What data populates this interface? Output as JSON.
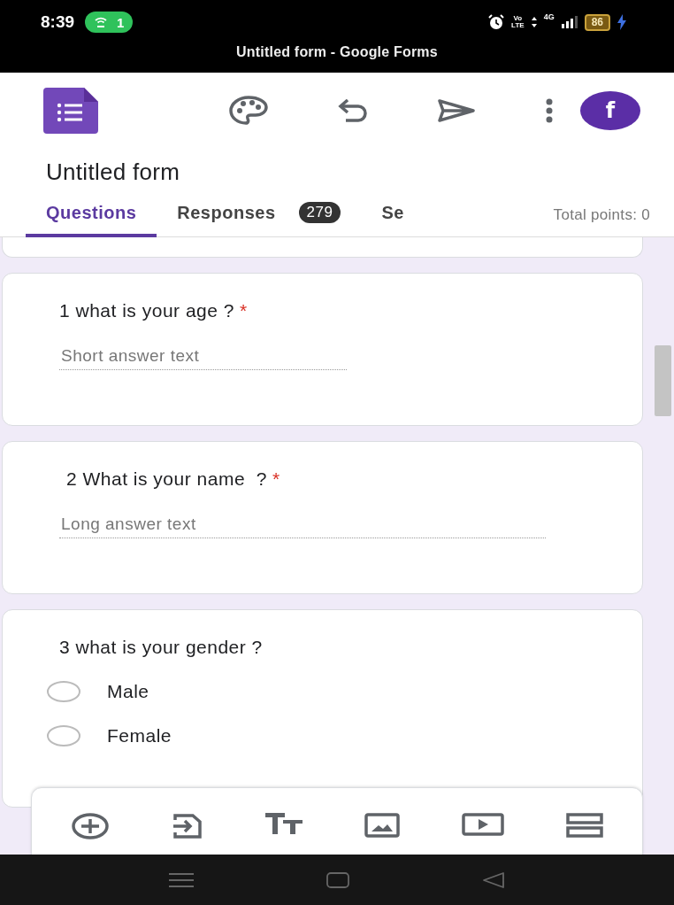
{
  "status_bar": {
    "time": "8:39",
    "hotspot_count": "1",
    "volte_label": "Vo",
    "lte_label": "LTE",
    "network_label": "4G",
    "battery": "86"
  },
  "app_title": "Untitled form - Google Forms",
  "header": {
    "avatar_letter": "f",
    "form_title": "Untitled form",
    "tabs": [
      {
        "label": "Questions",
        "selected": true
      },
      {
        "label": "Responses",
        "selected": false,
        "badge": "279"
      },
      {
        "label": "Se",
        "selected": false
      }
    ],
    "total_points": "Total points: 0"
  },
  "questions": [
    {
      "kind": "short",
      "title": "1 what is your age ?",
      "required_mark": "*",
      "placeholder": "Short answer text"
    },
    {
      "kind": "paragraph",
      "title": "2 What is your name  ?",
      "required_mark": "*",
      "placeholder": "Long answer text"
    },
    {
      "kind": "choice",
      "title": "3 what is your gender ?",
      "options": [
        {
          "label": "Male",
          "selected": false
        },
        {
          "label": "Female",
          "selected": false
        }
      ]
    }
  ]
}
